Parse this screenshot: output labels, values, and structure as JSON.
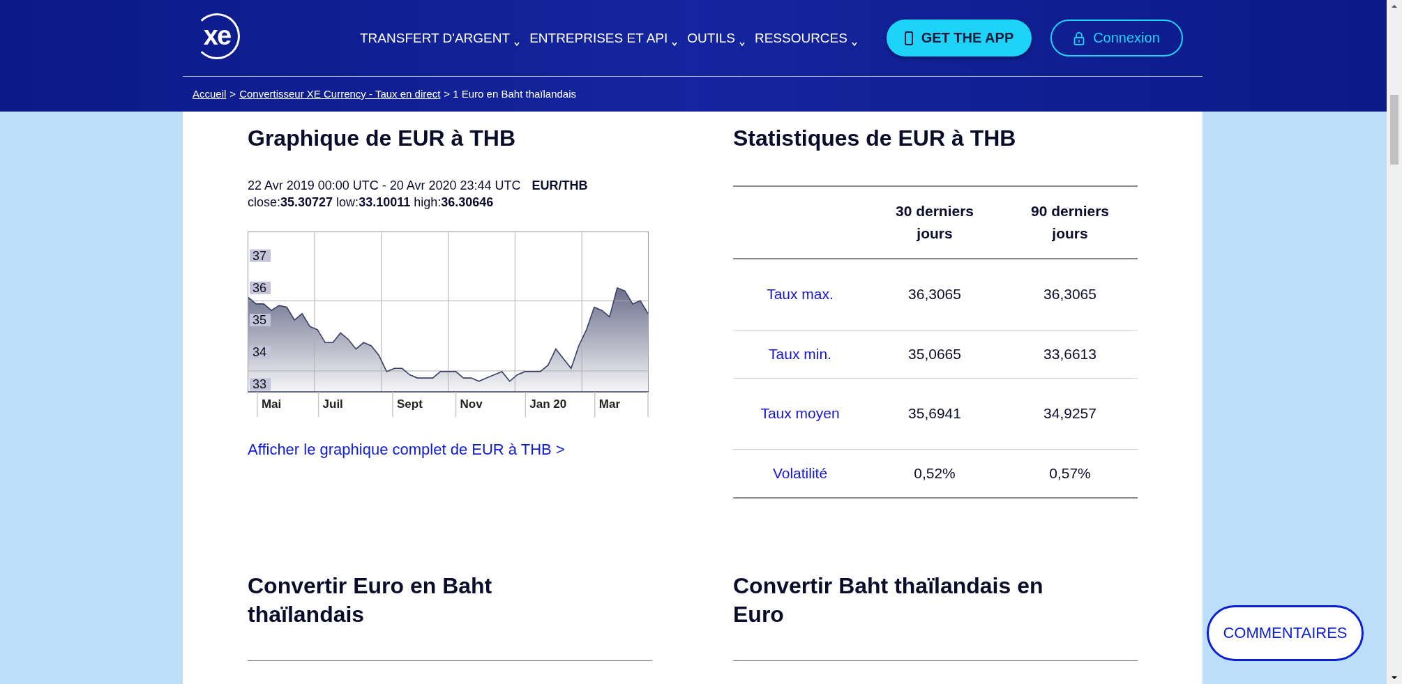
{
  "header": {
    "logo": "xe",
    "nav": [
      {
        "label": "TRANSFERT D'ARGENT"
      },
      {
        "label": "ENTREPRISES ET API"
      },
      {
        "label": "OUTILS"
      },
      {
        "label": "RESSOURCES"
      }
    ],
    "app_button": "GET THE APP",
    "login_button": "Connexion",
    "breadcrumb": [
      {
        "label": "Accueil",
        "kind": "link"
      },
      {
        "label": ">",
        "kind": "sep"
      },
      {
        "label": "Convertisseur XE Currency - Taux en direct",
        "kind": "link"
      },
      {
        "label": "> 1 Euro en Baht thaïlandais",
        "kind": "current"
      }
    ]
  },
  "chart_section": {
    "title": "Graphique de EUR à THB",
    "period": "22 Avr 2019 00:00 UTC - 20 Avr 2020 23:44 UTC",
    "pair": "EUR/THB",
    "summary": "close:**35.30727** low:**33.10011** high:**36.30646**",
    "chart_data": {
      "type": "area",
      "categories": [
        null,
        null,
        null,
        "Mai",
        null,
        null,
        null,
        null,
        null,
        null,
        null,
        "Juil",
        null,
        null,
        null,
        null,
        null,
        null,
        null,
        null,
        null,
        "Sept",
        null,
        null,
        null,
        null,
        null,
        null,
        null,
        "Nov",
        null,
        null,
        null,
        null,
        null,
        null,
        null,
        null,
        null,
        "Jan 20",
        null,
        null,
        null,
        null,
        null,
        null,
        null,
        "Mar",
        null,
        null,
        null,
        null,
        null
      ],
      "series": [
        {
          "color": "#3a3f66",
          "values": [
            35.7,
            35.5,
            35.5,
            35.3,
            35.45,
            35.4,
            35.0,
            35.2,
            34.8,
            34.7,
            34.3,
            34.3,
            34.6,
            34.4,
            34.1,
            34.3,
            34.2,
            33.9,
            33.4,
            33.5,
            33.5,
            33.3,
            33.2,
            33.2,
            33.2,
            33.4,
            33.4,
            33.4,
            33.2,
            33.2,
            33.1,
            33.2,
            33.3,
            33.4,
            33.1,
            33.3,
            33.4,
            33.4,
            33.4,
            33.6,
            34.1,
            33.8,
            33.5,
            34.2,
            34.7,
            35.4,
            35.3,
            35.1,
            36.0,
            35.9,
            35.5,
            35.6,
            35.2
          ]
        }
      ],
      "ylim": [
        32.77,
        37.75
      ],
      "yticks": [
        33,
        34,
        35,
        36,
        37
      ]
    },
    "link": "Afficher le graphique complet de EUR à THB >"
  },
  "stats_section": {
    "title": "Statistiques de EUR à THB",
    "columns": [
      "30 derniers jours",
      "90 derniers jours"
    ],
    "rows": [
      {
        "label": "Taux max.",
        "values": [
          "36,3065",
          "36,3065"
        ]
      },
      {
        "label": "Taux min.",
        "values": [
          "35,0665",
          "33,6613"
        ]
      },
      {
        "label": "Taux moyen",
        "values": [
          "35,6941",
          "34,9257"
        ]
      },
      {
        "label": "Volatilité",
        "values": [
          "0,52%",
          "0,57%"
        ]
      }
    ]
  },
  "convert_sections": [
    {
      "title": "Convertir Euro en Baht thaïlandais"
    },
    {
      "title": "Convertir Baht thaïlandais en Euro"
    }
  ],
  "feedback_button": "COMMENTAIRES"
}
